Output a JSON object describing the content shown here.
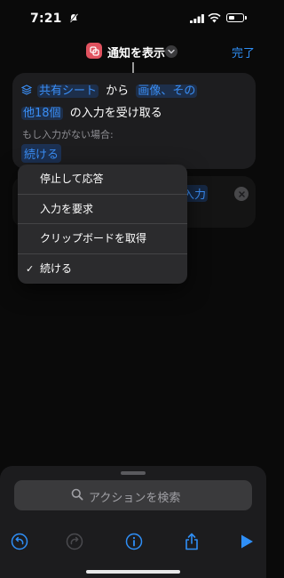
{
  "status_bar": {
    "time": "7:21"
  },
  "nav": {
    "title": "通知を表示",
    "done_label": "完了"
  },
  "action": {
    "source_share": "共有シート",
    "from_word": "から",
    "types_line1": "画像、その",
    "types_line2": "他18個",
    "receive_text": "の入力を受け取る",
    "if_no_input_label": "もし入力がない場合:",
    "continue_value": "続ける"
  },
  "next_card": {
    "partial_text": "入力"
  },
  "dropdown": {
    "items": [
      {
        "label": "停止して応答",
        "checked": false
      },
      {
        "label": "入力を要求",
        "checked": false
      },
      {
        "label": "クリップボードを取得",
        "checked": false
      },
      {
        "label": "続ける",
        "checked": true
      }
    ],
    "check_mark": "✓"
  },
  "bottom_sheet": {
    "search_placeholder": "アクションを検索"
  },
  "colors": {
    "accent": "#2f8ff7",
    "app_icon": "#e0525f",
    "card_bg": "#1d1d1f",
    "menu_bg": "#2b2b2d"
  }
}
